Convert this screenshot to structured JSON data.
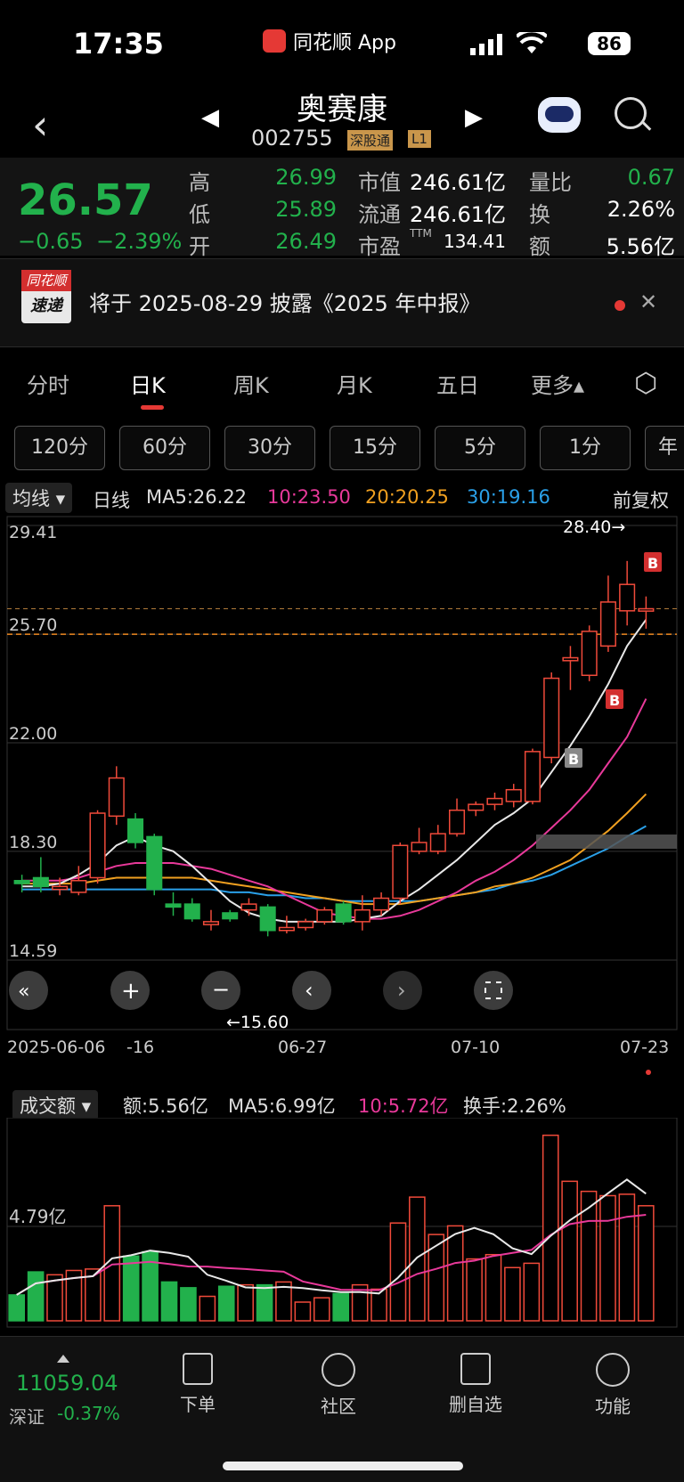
{
  "status_bar": {
    "time": "17:35",
    "app_name": "同花顺 App",
    "battery": "86"
  },
  "nav": {
    "stock_name": "奥赛康",
    "stock_code": "002755",
    "tag_exchange": "深股通",
    "tag_level": "L1"
  },
  "quote": {
    "price": "26.57",
    "change": "−0.65",
    "change_pct": "−2.39%",
    "high_label": "高",
    "high": "26.99",
    "low_label": "低",
    "low": "25.89",
    "open_label": "开",
    "open": "26.49",
    "mcap_label": "市值",
    "mcap": "246.61亿",
    "float_label": "流通",
    "float": "246.61亿",
    "pe_label": "市盈",
    "pe_sup": "TTM",
    "pe": "134.41",
    "vr_label": "量比",
    "vr": "0.67",
    "turnover_label": "换",
    "turnover": "2.26%",
    "amount_label": "额",
    "amount": "5.56亿"
  },
  "notice": {
    "badge_top": "同花顺",
    "badge_bottom": "速递",
    "text": "将于 2025-08-29 披露《2025 年中报》"
  },
  "tabs": [
    "分时",
    "日K",
    "周K",
    "月K",
    "五日",
    "更多▴"
  ],
  "periods": [
    "120分",
    "60分",
    "30分",
    "15分",
    "5分",
    "1分",
    "年"
  ],
  "ma_bar": {
    "selector": "均线 ▾",
    "period": "日线",
    "ma5": "MA5:26.22",
    "ma10": "10:23.50",
    "ma20": "20:20.25",
    "ma30": "30:19.16",
    "adjust": "前复权"
  },
  "colors": {
    "up": "#f04a3a",
    "down": "#22b14c",
    "ma5": "#e8e8e8",
    "ma10": "#e8399a",
    "ma20": "#f0a020",
    "ma30": "#2aa0e8"
  },
  "chart_data": {
    "type": "candlestick",
    "y_ticks": [
      "29.41",
      "25.70",
      "22.00",
      "18.30",
      "14.59"
    ],
    "ylim": [
      14.59,
      29.41
    ],
    "x_labels": [
      "2025-06-06",
      "-16",
      "06-27",
      "07-10",
      "07-23"
    ],
    "annotations": {
      "high": "28.40→",
      "low": "←15.60"
    },
    "candles": [
      {
        "o": 17.3,
        "c": 17.2,
        "h": 17.5,
        "l": 16.9
      },
      {
        "o": 17.4,
        "c": 17.1,
        "h": 18.1,
        "l": 16.9
      },
      {
        "o": 17.0,
        "c": 17.1,
        "h": 17.4,
        "l": 16.8
      },
      {
        "o": 16.9,
        "c": 17.3,
        "h": 17.8,
        "l": 16.8
      },
      {
        "o": 17.4,
        "c": 19.6,
        "h": 19.7,
        "l": 17.2
      },
      {
        "o": 19.5,
        "c": 20.8,
        "h": 21.2,
        "l": 19.2
      },
      {
        "o": 19.4,
        "c": 18.6,
        "h": 19.6,
        "l": 18.4
      },
      {
        "o": 18.8,
        "c": 17.0,
        "h": 18.9,
        "l": 16.8
      },
      {
        "o": 16.5,
        "c": 16.4,
        "h": 16.9,
        "l": 16.1
      },
      {
        "o": 16.5,
        "c": 16.0,
        "h": 16.7,
        "l": 15.9
      },
      {
        "o": 15.8,
        "c": 15.9,
        "h": 16.3,
        "l": 15.6
      },
      {
        "o": 16.2,
        "c": 16.0,
        "h": 16.3,
        "l": 15.9
      },
      {
        "o": 16.3,
        "c": 16.5,
        "h": 16.7,
        "l": 16.1
      },
      {
        "o": 16.4,
        "c": 15.6,
        "h": 16.5,
        "l": 15.4
      },
      {
        "o": 15.6,
        "c": 15.7,
        "h": 16.1,
        "l": 15.5
      },
      {
        "o": 15.7,
        "c": 15.9,
        "h": 16.0,
        "l": 15.6
      },
      {
        "o": 15.9,
        "c": 16.3,
        "h": 16.4,
        "l": 15.8
      },
      {
        "o": 16.5,
        "c": 15.9,
        "h": 16.6,
        "l": 15.8
      },
      {
        "o": 15.9,
        "c": 16.3,
        "h": 16.8,
        "l": 15.6
      },
      {
        "o": 16.3,
        "c": 16.7,
        "h": 16.9,
        "l": 16.1
      },
      {
        "o": 16.7,
        "c": 18.5,
        "h": 18.6,
        "l": 16.5
      },
      {
        "o": 18.3,
        "c": 18.6,
        "h": 19.1,
        "l": 18.2
      },
      {
        "o": 18.3,
        "c": 18.9,
        "h": 19.2,
        "l": 18.2
      },
      {
        "o": 18.9,
        "c": 19.7,
        "h": 20.1,
        "l": 18.8
      },
      {
        "o": 19.7,
        "c": 19.9,
        "h": 20.0,
        "l": 19.5
      },
      {
        "o": 19.9,
        "c": 20.1,
        "h": 20.3,
        "l": 19.7
      },
      {
        "o": 20.0,
        "c": 20.4,
        "h": 20.6,
        "l": 19.8
      },
      {
        "o": 20.0,
        "c": 21.7,
        "h": 21.8,
        "l": 19.9
      },
      {
        "o": 21.5,
        "c": 24.2,
        "h": 24.4,
        "l": 21.3
      },
      {
        "o": 24.8,
        "c": 24.9,
        "h": 25.3,
        "l": 23.8
      },
      {
        "o": 24.3,
        "c": 25.8,
        "h": 26.0,
        "l": 24.1
      },
      {
        "o": 25.3,
        "c": 26.8,
        "h": 27.7,
        "l": 25.1
      },
      {
        "o": 26.5,
        "c": 27.4,
        "h": 28.2,
        "l": 26.0
      },
      {
        "o": 26.49,
        "c": 26.57,
        "h": 26.99,
        "l": 25.89
      }
    ],
    "ma5": [
      17.1,
      17.1,
      17.2,
      17.5,
      17.9,
      18.5,
      18.8,
      18.5,
      18.3,
      17.8,
      17.2,
      16.6,
      16.2,
      16.0,
      15.9,
      15.9,
      15.9,
      15.9,
      16.0,
      16.1,
      16.6,
      17.0,
      17.5,
      18.0,
      18.6,
      19.2,
      19.6,
      20.1,
      21.0,
      21.9,
      22.9,
      24.0,
      25.3,
      26.2
    ],
    "ma10": [
      17.3,
      17.3,
      17.3,
      17.4,
      17.6,
      17.8,
      17.9,
      17.9,
      17.9,
      17.8,
      17.7,
      17.5,
      17.3,
      17.1,
      16.8,
      16.5,
      16.2,
      16.1,
      16.0,
      16.0,
      16.1,
      16.3,
      16.6,
      16.9,
      17.3,
      17.6,
      18.0,
      18.5,
      19.1,
      19.7,
      20.4,
      21.3,
      22.2,
      23.5
    ],
    "ma20": [
      17.2,
      17.2,
      17.2,
      17.2,
      17.3,
      17.4,
      17.4,
      17.4,
      17.4,
      17.4,
      17.3,
      17.2,
      17.1,
      17.0,
      16.9,
      16.8,
      16.7,
      16.6,
      16.5,
      16.5,
      16.5,
      16.6,
      16.7,
      16.8,
      16.9,
      17.1,
      17.2,
      17.4,
      17.7,
      18.0,
      18.5,
      19.0,
      19.6,
      20.25
    ],
    "ma30": [
      17.0,
      17.0,
      17.0,
      17.0,
      17.0,
      17.0,
      17.0,
      17.0,
      17.0,
      17.0,
      17.0,
      16.9,
      16.9,
      16.8,
      16.8,
      16.7,
      16.7,
      16.6,
      16.6,
      16.6,
      16.6,
      16.6,
      16.7,
      16.8,
      16.9,
      17.0,
      17.2,
      17.3,
      17.5,
      17.8,
      18.1,
      18.4,
      18.8,
      19.16
    ]
  },
  "volume_header": {
    "selector": "成交额 ▾",
    "amount": "额:5.56亿",
    "ma5": "MA5:6.99亿",
    "ma10": "10:5.72亿",
    "turnover": "换手:2.26%"
  },
  "volume_data": {
    "y_tick": "4.79亿",
    "values": [
      1.8,
      3.4,
      3.2,
      3.5,
      3.6,
      8.0,
      4.5,
      4.8,
      2.7,
      2.3,
      1.7,
      2.4,
      2.5,
      2.5,
      2.7,
      1.3,
      1.6,
      1.9,
      2.5,
      2.2,
      6.8,
      8.6,
      6.0,
      6.6,
      4.3,
      4.6,
      3.7,
      4.0,
      12.9,
      9.7,
      9.0,
      8.7,
      8.8,
      8.0
    ]
  },
  "bottom": {
    "index_value": "11059.04",
    "index_name": "深证",
    "index_change": "-0.37%",
    "btn_order": "下单",
    "btn_community": "社区",
    "btn_remove": "删自选",
    "btn_functions": "功能"
  }
}
